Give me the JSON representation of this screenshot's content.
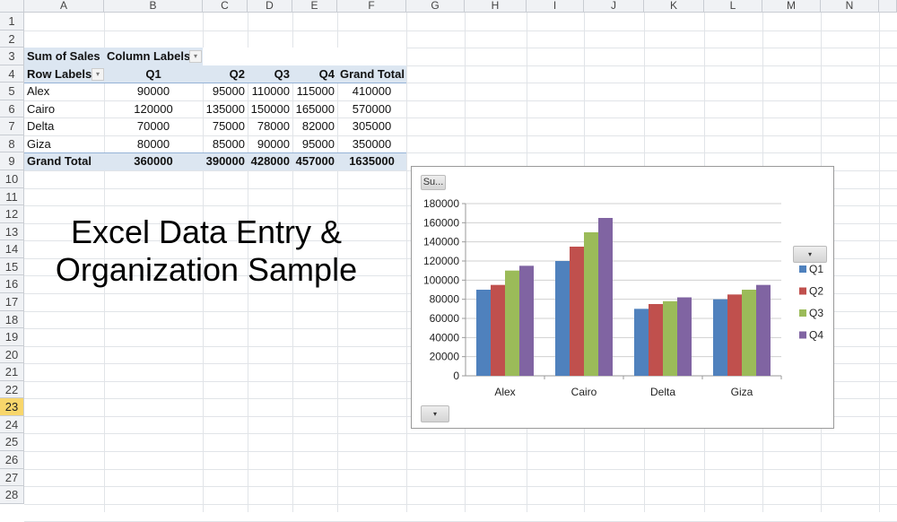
{
  "columns": [
    "A",
    "B",
    "C",
    "D",
    "E",
    "F",
    "G",
    "H",
    "I",
    "J",
    "K",
    "L",
    "M",
    "N"
  ],
  "rows": [
    "1",
    "2",
    "3",
    "4",
    "5",
    "6",
    "7",
    "8",
    "9",
    "10",
    "11",
    "12",
    "13",
    "14",
    "15",
    "16",
    "17",
    "18",
    "19",
    "20",
    "21",
    "22",
    "23",
    "24",
    "25",
    "26",
    "27",
    "28"
  ],
  "selected_row": "23",
  "pivot": {
    "corner": "Sum of Sales",
    "column_labels": "Column Labels",
    "row_labels": "Row Labels",
    "headers": [
      "Q1",
      "Q2",
      "Q3",
      "Q4",
      "Grand Total"
    ],
    "body": [
      {
        "label": "Alex",
        "values": [
          "90000",
          "95000",
          "110000",
          "115000",
          "410000"
        ]
      },
      {
        "label": "Cairo",
        "values": [
          "120000",
          "135000",
          "150000",
          "165000",
          "570000"
        ]
      },
      {
        "label": "Delta",
        "values": [
          "70000",
          "75000",
          "78000",
          "82000",
          "305000"
        ]
      },
      {
        "label": "Giza",
        "values": [
          "80000",
          "85000",
          "90000",
          "95000",
          "350000"
        ]
      }
    ],
    "total": {
      "label": "Grand Total",
      "values": [
        "360000",
        "390000",
        "428000",
        "457000",
        "1635000"
      ]
    }
  },
  "title_line1": "Excel Data Entry &",
  "title_line2": "Organization Sample",
  "chart_buttons": {
    "values_field": "Su...",
    "legend_field": "▾",
    "axis_field": "▾"
  },
  "chart_data": {
    "type": "bar",
    "title": "",
    "xlabel": "",
    "ylabel": "",
    "categories": [
      "Alex",
      "Cairo",
      "Delta",
      "Giza"
    ],
    "ylim": [
      0,
      180000
    ],
    "yticks": [
      "0",
      "20000",
      "40000",
      "60000",
      "80000",
      "100000",
      "120000",
      "140000",
      "160000",
      "180000"
    ],
    "grid": true,
    "legend": "right",
    "series": [
      {
        "name": "Q1",
        "color": "#4f81bd",
        "values": [
          90000,
          120000,
          70000,
          80000
        ]
      },
      {
        "name": "Q2",
        "color": "#c0504d",
        "values": [
          95000,
          135000,
          75000,
          85000
        ]
      },
      {
        "name": "Q3",
        "color": "#9bbb59",
        "values": [
          110000,
          150000,
          78000,
          90000
        ]
      },
      {
        "name": "Q4",
        "color": "#8064a2",
        "values": [
          115000,
          165000,
          82000,
          95000
        ]
      }
    ]
  }
}
